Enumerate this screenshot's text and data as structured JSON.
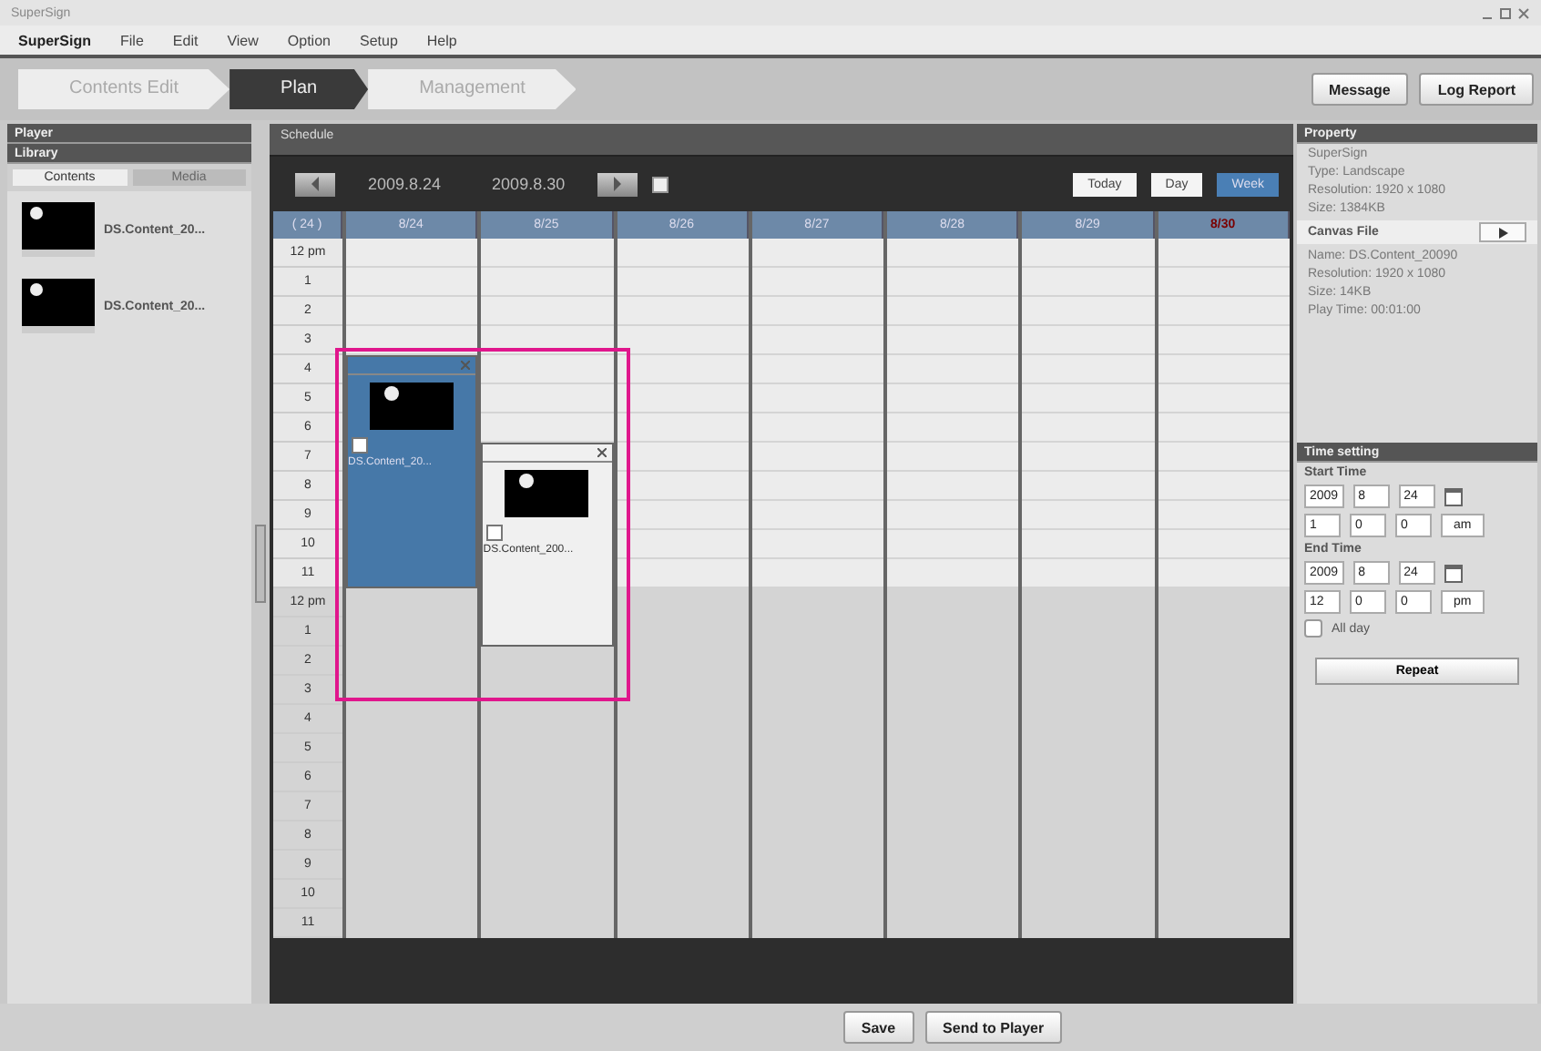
{
  "window": {
    "title": "SuperSign"
  },
  "menu": [
    "SuperSign",
    "File",
    "Edit",
    "View",
    "Option",
    "Setup",
    "Help"
  ],
  "mode_tabs": [
    {
      "label": "Contents Edit",
      "selected": false
    },
    {
      "label": "Plan",
      "selected": true
    },
    {
      "label": "Management",
      "selected": false
    }
  ],
  "top_buttons": [
    "Message",
    "Log Report"
  ],
  "left_panel": {
    "player_title": "Player",
    "library_title": "Library",
    "tabs": [
      {
        "label": "Contents",
        "selected": true
      },
      {
        "label": "Media",
        "selected": false
      }
    ],
    "items": [
      {
        "name": "DS.Content_20..."
      },
      {
        "name": "DS.Content_20..."
      }
    ]
  },
  "schedule": {
    "title": "Schedule",
    "start_date": "2009.8.24",
    "end_date": "2009.8.30",
    "view_buttons": [
      {
        "label": "Today",
        "selected": false
      },
      {
        "label": "Day",
        "selected": false
      },
      {
        "label": "Week",
        "selected": true
      }
    ],
    "week_label": "( 24 )",
    "hours": [
      "12 pm",
      "1",
      "2",
      "3",
      "4",
      "5",
      "6",
      "7",
      "8",
      "9",
      "10",
      "11",
      "12 pm",
      "1",
      "2",
      "3",
      "4",
      "5",
      "6",
      "7",
      "8",
      "9",
      "10",
      "11"
    ],
    "columns": [
      {
        "label": "8/24",
        "holiday": false,
        "events": [
          {
            "name": "DS.Content_20...",
            "selected": true
          }
        ]
      },
      {
        "label": "8/25",
        "holiday": false,
        "events": [
          {
            "name": "DS.Content_200...",
            "selected": false
          }
        ]
      },
      {
        "label": "8/26",
        "holiday": false
      },
      {
        "label": "8/27",
        "holiday": false
      },
      {
        "label": "8/28",
        "holiday": false
      },
      {
        "label": "8/29",
        "holiday": false
      },
      {
        "label": "8/30",
        "holiday": true
      }
    ]
  },
  "property": {
    "title": "Property",
    "lines_top": [
      "SuperSign",
      "Type: Landscape",
      "Resolution: 1920 x 1080",
      "Size: 1384KB"
    ],
    "canvas_label": "Canvas File",
    "lines_bottom": [
      "Name: DS.Content_20090",
      "Resolution: 1920 x 1080",
      "Size: 14KB",
      "Play Time: 00:01:00"
    ]
  },
  "time_setting": {
    "title": "Time setting",
    "start": {
      "label": "Start Time",
      "date": [
        "2009",
        "8",
        "24"
      ],
      "time": [
        "1",
        "0",
        "0"
      ],
      "ampm": "am"
    },
    "end": {
      "label": "End Time",
      "date": [
        "2009",
        "8",
        "24"
      ],
      "time": [
        "12",
        "0",
        "0"
      ],
      "ampm": "pm"
    },
    "all_day": {
      "label": "All day",
      "checked": false
    },
    "repeat_button": "Repeat"
  },
  "bottom_buttons": [
    "Save",
    "Send to Player"
  ]
}
